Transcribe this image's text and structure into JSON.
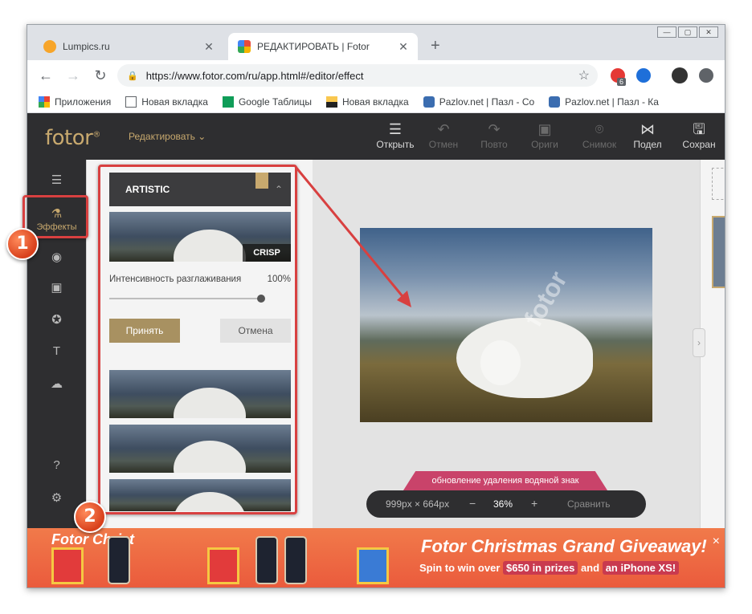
{
  "browser": {
    "tabs": [
      {
        "title": "Lumpics.ru",
        "active": false
      },
      {
        "title": "РЕДАКТИРОВАТЬ | Fotor",
        "active": true
      }
    ],
    "url": "https://www.fotor.com/ru/app.html#/editor/effect",
    "ext_badge": "6",
    "bookmarks": [
      {
        "label": "Приложения",
        "icon": "apps-grid-icon"
      },
      {
        "label": "Новая вкладка",
        "icon": "page-icon"
      },
      {
        "label": "Google Таблицы",
        "icon": "sheets-icon"
      },
      {
        "label": "Новая вкладка",
        "icon": "image-icon"
      },
      {
        "label": "Pazlov.net | Пазл - Со",
        "icon": "puzzle-icon"
      },
      {
        "label": "Pazlov.net | Пазл - Ка",
        "icon": "puzzle-icon"
      }
    ]
  },
  "app": {
    "logo": "fotor",
    "edit_menu": "Редактировать",
    "toolbar": [
      {
        "label": "Открыть",
        "icon": "menu-icon",
        "enabled": true
      },
      {
        "label": "Отмен",
        "icon": "undo-icon",
        "enabled": false
      },
      {
        "label": "Повто",
        "icon": "redo-icon",
        "enabled": false
      },
      {
        "label": "Ориги",
        "icon": "original-icon",
        "enabled": false
      },
      {
        "label": "Снимок",
        "icon": "snapshot-icon",
        "enabled": false
      },
      {
        "label": "Подел",
        "icon": "share-icon",
        "enabled": true
      },
      {
        "label": "Сохран",
        "icon": "save-icon",
        "enabled": true
      }
    ],
    "sidebar": {
      "active_label": "Эффекты",
      "icons": [
        "adjust-icon",
        "effects-icon",
        "eye-icon",
        "frame-icon",
        "sticker-icon",
        "text-icon",
        "upload-icon",
        "help-icon",
        "settings-icon"
      ]
    },
    "panel": {
      "section": "ARTISTIC",
      "preset": "CRISP",
      "intensity_label": "Интенсивность разглаживания",
      "intensity_value": "100%",
      "intensity": 1.0,
      "accept": "Принять",
      "cancel": "Отмена"
    },
    "canvas": {
      "watermark": "fotor",
      "update_banner": "обновление удаления водяной знак",
      "size": "999px × 664px",
      "minus": "−",
      "zoom": "36%",
      "plus": "+",
      "compare": "Сравнить"
    },
    "ad": {
      "left_text": "Fotor Christ",
      "title": "Fotor Christmas Grand Giveaway!",
      "sub_a": "Spin to win over",
      "sub_prize": "$650 in prizes",
      "sub_and": "and",
      "sub_phone": "an iPhone XS!",
      "close": "×"
    }
  },
  "annotations": {
    "marker_1": "1",
    "marker_2": "2"
  }
}
